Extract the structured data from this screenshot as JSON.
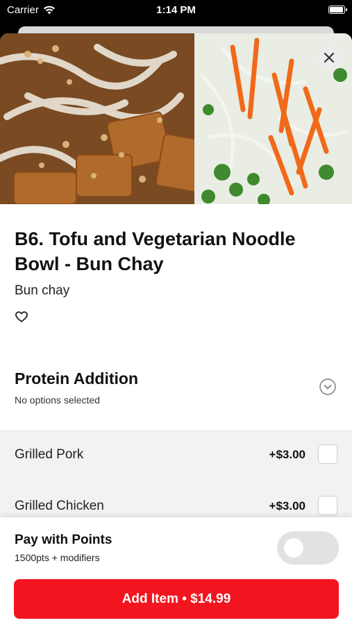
{
  "status_bar": {
    "carrier": "Carrier",
    "time": "1:14 PM",
    "battery_level": 1.0
  },
  "item": {
    "title": "B6. Tofu and Vegetarian Noodle Bowl - Bun Chay",
    "subtitle": "Bun chay"
  },
  "modifier_group": {
    "title": "Protein Addition",
    "status": "No options selected",
    "options": [
      {
        "name": "Grilled Pork",
        "price": "+$3.00",
        "selected": false
      },
      {
        "name": "Grilled Chicken",
        "price": "+$3.00",
        "selected": false
      }
    ]
  },
  "footer": {
    "points_label": "Pay with Points",
    "points_detail": "1500pts + modifiers",
    "points_toggle_on": false,
    "add_button_label": "Add Item • $14.99"
  },
  "colors": {
    "accent": "#f2141e",
    "toggle_off": "#e2e2e2",
    "options_bg": "#f2f2f2"
  },
  "icons": [
    "wifi-icon",
    "battery-icon",
    "close-icon",
    "heart-icon",
    "chevron-down-icon"
  ]
}
